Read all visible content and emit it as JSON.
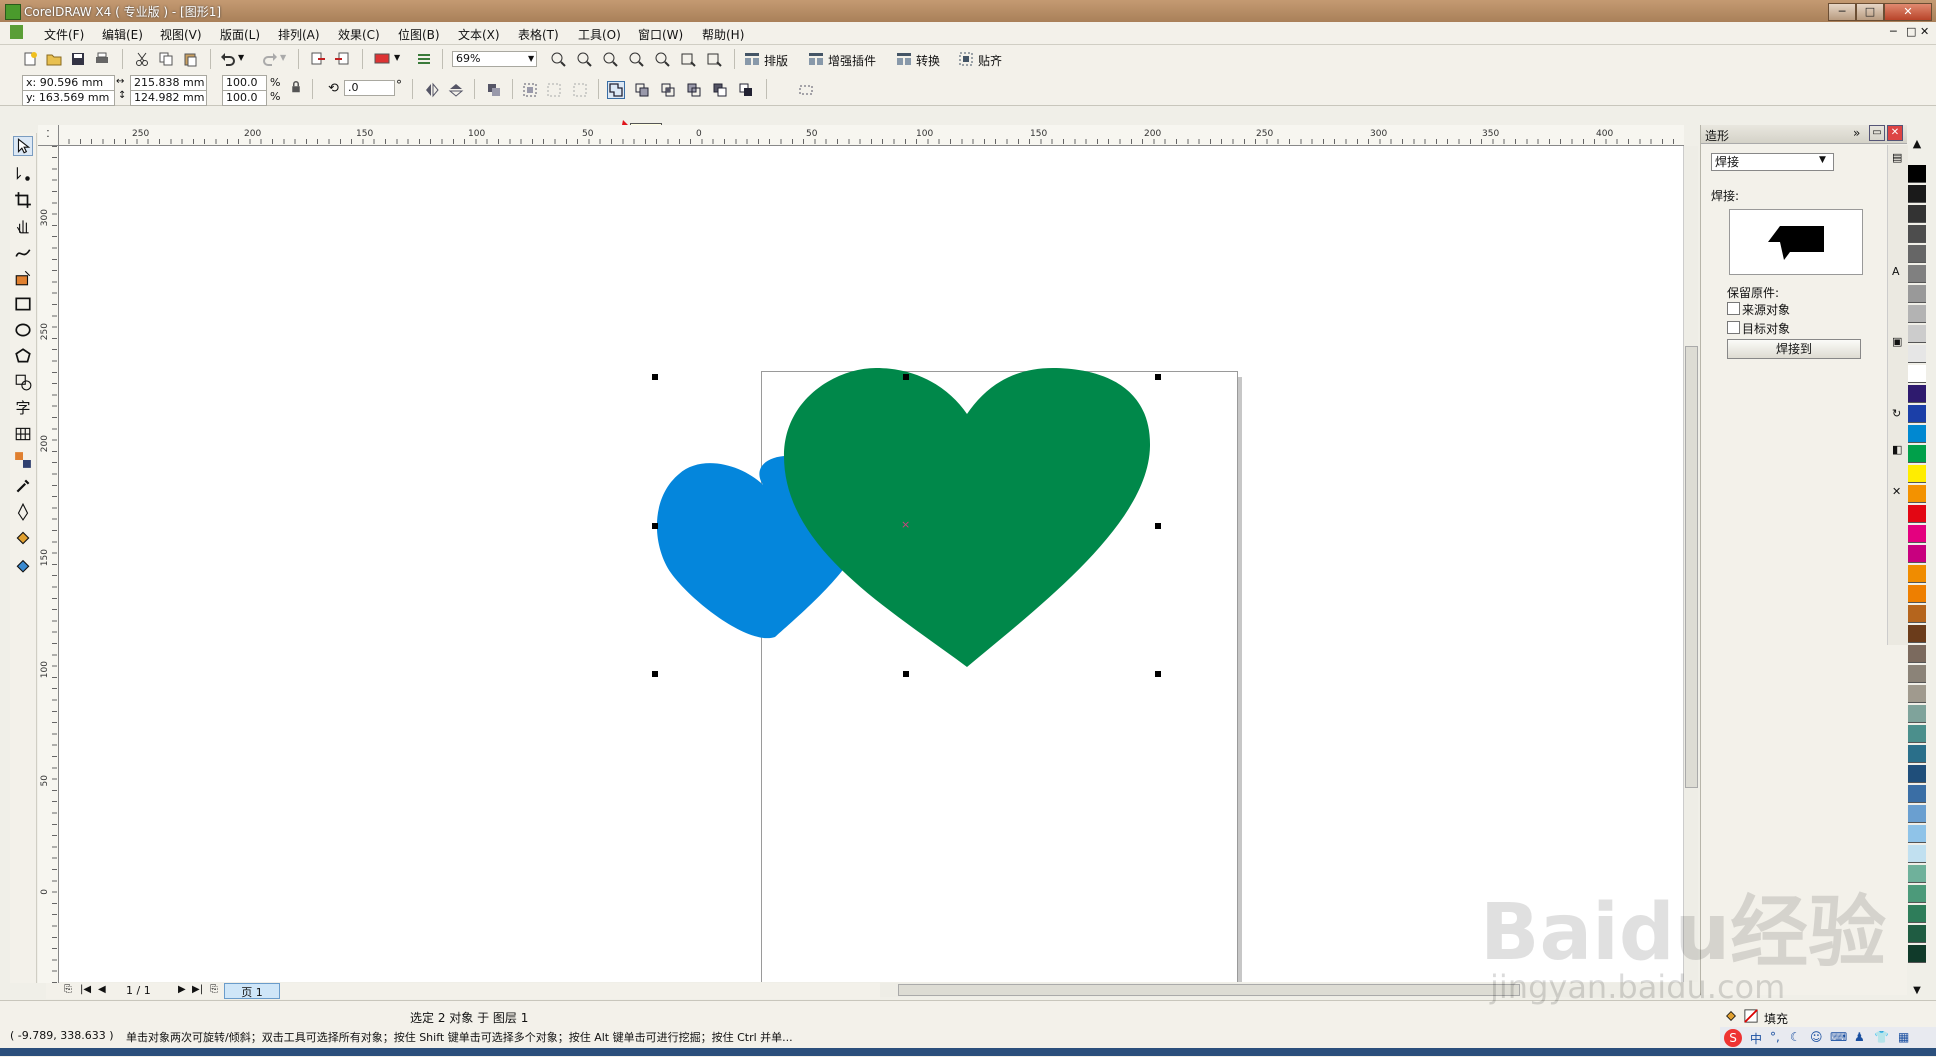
{
  "window": {
    "title": "CorelDRAW X4 ( 专业版 ) - [图形1]",
    "controls": [
      "─",
      "□",
      "✕"
    ]
  },
  "menu": {
    "items": [
      "文件(F)",
      "编辑(E)",
      "视图(V)",
      "版面(L)",
      "排列(A)",
      "效果(C)",
      "位图(B)",
      "文本(X)",
      "表格(T)",
      "工具(O)",
      "窗口(W)",
      "帮助(H)"
    ]
  },
  "toolbar": {
    "zoom": "69%",
    "layout_label": "排版",
    "plugin_label": "增强插件",
    "convert_label": "转换",
    "snap_label": "贴齐"
  },
  "propbar": {
    "x": "x: 90.596 mm",
    "y": "y: 163.569 mm",
    "width": "215.838 mm",
    "height": "124.982 mm",
    "scale_x": "100.0",
    "scale_y": "100.0",
    "percent": "%",
    "angle": ".0",
    "degree": "°"
  },
  "tooltip": "焊接",
  "ruler": {
    "h_labels": [
      "250",
      "200",
      "150",
      "100",
      "50",
      "0",
      "50",
      "100",
      "150",
      "200",
      "250",
      "300",
      "350",
      "400"
    ],
    "v_labels": [
      "300",
      "250",
      "200",
      "150",
      "100",
      "50",
      "0"
    ]
  },
  "docker": {
    "title": "造形",
    "mode": "焊接",
    "section_label": "焊接:",
    "keep_original_label": "保留原件:",
    "source_object_label": "来源对象",
    "target_object_label": "目标对象",
    "apply_button": "焊接到",
    "source_checked": false,
    "target_checked": false
  },
  "pagenav": {
    "page_count": "1 / 1",
    "page_tab": "页 1"
  },
  "status": {
    "selection": "选定 2 对象 于 图层 1",
    "coords": "( -9.789, 338.633 )",
    "hint": "单击对象两次可旋转/倾斜；双击工具可选择所有对象；按住 Shift 键单击可选择多个对象；按住 Alt 键单击可进行挖掘；按住 Ctrl 并单...",
    "fill_label": "填充"
  },
  "colors": {
    "blue_heart": "#0486dc",
    "green_heart": "#00884a",
    "accent_arrow": "#e0151b"
  },
  "palette": [
    "#000000",
    "#1a1a1a",
    "#333333",
    "#4d4d4d",
    "#666666",
    "#808080",
    "#999999",
    "#b3b3b3",
    "#cccccc",
    "#e6e6e6",
    "#ffffff",
    "#2e1a6e",
    "#1b3fa8",
    "#0088d1",
    "#00a04a",
    "#ffed00",
    "#f39200",
    "#e30613",
    "#e4007f",
    "#c8007f",
    "#f08c00",
    "#ee7f00",
    "#b5651d",
    "#6b3c1b",
    "#7b6a5e",
    "#8b8378",
    "#a09a8e",
    "#7fa39b",
    "#4b8f8c",
    "#2a6f8a",
    "#1f4e7a",
    "#3a6ea5",
    "#6a9fd0",
    "#8fc3e8",
    "#c1e0f0",
    "#6fb19b",
    "#4c9a7a",
    "#2e7d5a",
    "#1f5c42",
    "#103a2a"
  ],
  "watermark": {
    "main": "Baidu经验",
    "sub": "jingyan.baidu.com"
  }
}
